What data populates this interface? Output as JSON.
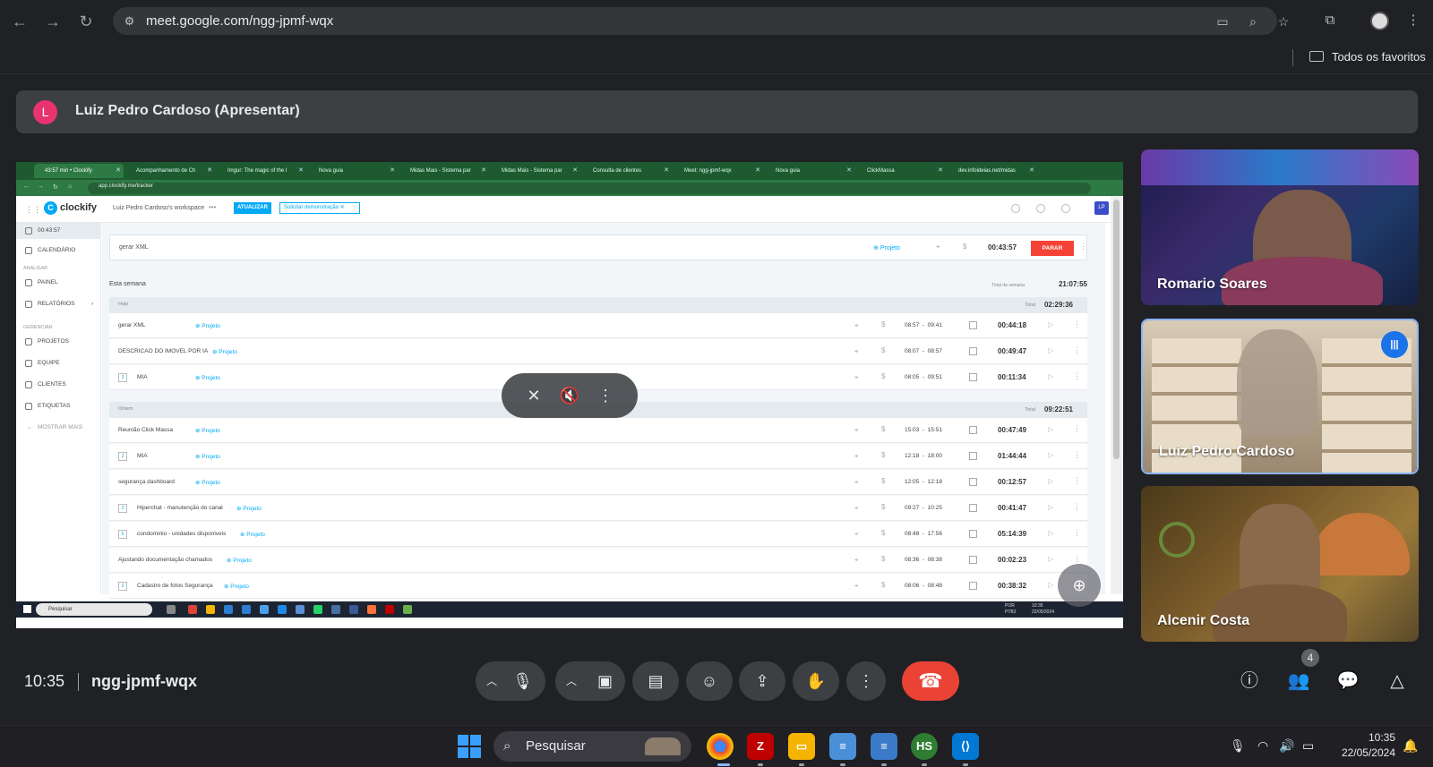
{
  "browser": {
    "url": "meet.google.com/ngg-jpmf-wqx",
    "bookmarks_label": "Todos os favoritos",
    "icons": [
      "back-icon",
      "forward-icon",
      "reload-icon",
      "tune-icon",
      "camera-icon",
      "zoom-icon",
      "star-icon",
      "extensions-icon",
      "profile-avatar",
      "menu-icon"
    ]
  },
  "presenter": {
    "initial": "L",
    "title": "Luiz Pedro Cardoso (Apresentar)"
  },
  "shared_screen": {
    "tabs": [
      "43:57 min • Clockify",
      "Acompanhamento de Ch",
      "Imgur: The magic of the I",
      "Nova guia",
      "Midas Mais - Sistema par",
      "Midas Mais - Sistema par",
      "Consulta de clientes",
      "Meet: ngg-jpmf-wqx",
      "Nova guia",
      "ClickMassa",
      "dev.infoideias.net/midas"
    ],
    "address": "app.clockify.me/tracker",
    "clockify": {
      "brand": "clockify",
      "workspace": "Luiz Pedro Cardoso's workspace",
      "upgrade_label": "ATUALIZAR",
      "demo_label": "Solicitar demonstração",
      "user_initials": "LP",
      "sidebar": {
        "timer": "00:43:57",
        "calendar": "CALENDÁRIO",
        "section_analyze": "ANALISAR",
        "dashboard": "PAINEL",
        "reports": "RELATÓRIOS",
        "section_manage": "GERENCIAR",
        "projects": "PROJETOS",
        "team": "EQUIPE",
        "clients": "CLIENTES",
        "tags": "ETIQUETAS",
        "show_more": "MOSTRAR MAIS"
      },
      "current_entry": {
        "description": "gerar XML",
        "project_label": "Projeto",
        "elapsed": "00:43:57",
        "stop_label": "PARAR"
      },
      "week": {
        "label": "Esta semana",
        "total_label": "Total da semana",
        "total": "21:07:55"
      },
      "groups": [
        {
          "label": "Hoje",
          "total_label": "Total",
          "total": "02:29:36",
          "entries": [
            {
              "badge": "",
              "description": "gerar XML",
              "project": "Projeto",
              "start": "08:57",
              "end": "09:41",
              "duration": "00:44:18"
            },
            {
              "badge": "",
              "description": "DESCRICAO DO IMOVEL POR IA",
              "project": "Projeto",
              "start": "08:07",
              "end": "08:57",
              "duration": "00:49:47"
            },
            {
              "badge": "3",
              "description": "MIA",
              "project": "Projeto",
              "start": "08:05",
              "end": "09:51",
              "duration": "00:11:34"
            }
          ]
        },
        {
          "label": "Ontem",
          "total_label": "Total",
          "total": "09:22:51",
          "entries": [
            {
              "badge": "",
              "description": "Reunião Click Massa",
              "project": "Projeto",
              "start": "15:03",
              "end": "15:51",
              "duration": "00:47:49"
            },
            {
              "badge": "2",
              "description": "MIA",
              "project": "Projeto",
              "start": "12:18",
              "end": "18:00",
              "duration": "01:44:44"
            },
            {
              "badge": "",
              "description": "segurança dashboard",
              "project": "Projeto",
              "start": "12:05",
              "end": "12:18",
              "duration": "00:12:57"
            },
            {
              "badge": "2",
              "description": "Hiperchat - manutenção do canal",
              "project": "Projeto",
              "start": "09:27",
              "end": "10:25",
              "duration": "00:41:47"
            },
            {
              "badge": "5",
              "description": "condominio - unidades disponiveis",
              "project": "Projeto",
              "start": "08:48",
              "end": "17:56",
              "duration": "05:14:39"
            },
            {
              "badge": "",
              "description": "Ajustando documentação chamados",
              "project": "Projeto",
              "start": "08:36",
              "end": "08:38",
              "duration": "00:02:23"
            },
            {
              "badge": "2",
              "description": "Cadastro de fotos Segurança",
              "project": "Projeto",
              "start": "08:06",
              "end": "08:48",
              "duration": "00:38:32"
            }
          ]
        }
      ]
    },
    "taskbar": {
      "search_label": "Pesquisar",
      "clock_time": "10:35",
      "clock_date": "22/05/2024",
      "lang": "POR PTB2"
    }
  },
  "participants": [
    {
      "name": "Romario Soares"
    },
    {
      "name": "Luiz Pedro Cardoso",
      "speaking": true
    },
    {
      "name": "Alcenir Costa"
    }
  ],
  "meet_bar": {
    "time": "10:35",
    "meeting_code": "ngg-jpmf-wqx",
    "participant_count": "4"
  },
  "windows_taskbar": {
    "search_label": "Pesquisar",
    "time": "10:35",
    "date": "22/05/2024",
    "apps": [
      "Chrome",
      "FileZilla",
      "File Explorer",
      "Notepad",
      "Notepad",
      "HeidiSQL",
      "Visual Studio Code"
    ],
    "heidisql_label": "HS"
  },
  "colors": {
    "meet_bg": "#202124",
    "end_call": "#ea4335",
    "speaking_border": "#8ab4f8",
    "clockify_blue": "#03a9f4",
    "stop_red": "#f44336"
  }
}
